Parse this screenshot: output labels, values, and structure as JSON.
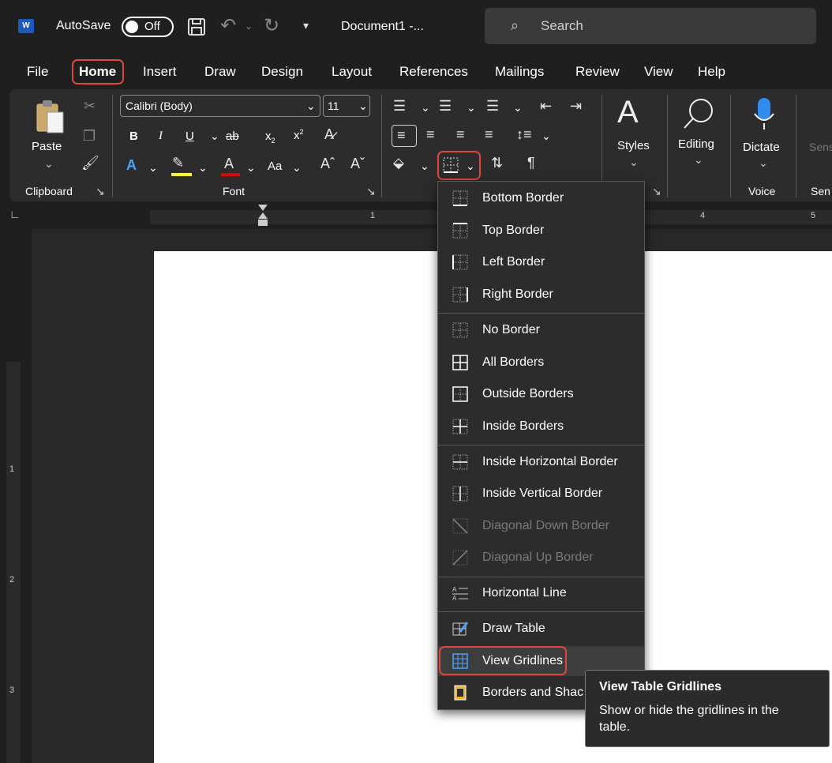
{
  "titlebar": {
    "autosave_label": "AutoSave",
    "autosave_state": "Off",
    "document_name": "Document1 -...",
    "search_placeholder": "Search"
  },
  "tabs": [
    "File",
    "Home",
    "Insert",
    "Draw",
    "Design",
    "Layout",
    "References",
    "Mailings",
    "Review",
    "View",
    "Help"
  ],
  "ribbon": {
    "paste_label": "Paste",
    "clipboard_group": "Clipboard",
    "font_name": "Calibri (Body)",
    "font_size": "11",
    "font_group": "Font",
    "styles_label": "Styles",
    "editing_label": "Editing",
    "dictate_label": "Dictate",
    "voice_group": "Voice",
    "sens_label": "Sens",
    "sens_group": "Sen"
  },
  "ruler": {
    "mark1": "1",
    "mark4": "4",
    "mark5": "5"
  },
  "vruler": {
    "mark1": "1",
    "mark2": "2",
    "mark3": "3"
  },
  "menu": {
    "items": [
      {
        "label": "Bottom Border",
        "icon": "bottom-border-icon",
        "enabled": true
      },
      {
        "label": "Top Border",
        "icon": "top-border-icon",
        "enabled": true
      },
      {
        "label": "Left Border",
        "icon": "left-border-icon",
        "enabled": true
      },
      {
        "label": "Right Border",
        "icon": "right-border-icon",
        "enabled": true
      },
      {
        "label": "No Border",
        "icon": "no-border-icon",
        "enabled": true
      },
      {
        "label": "All Borders",
        "icon": "all-borders-icon",
        "enabled": true
      },
      {
        "label": "Outside Borders",
        "icon": "outside-borders-icon",
        "enabled": true
      },
      {
        "label": "Inside Borders",
        "icon": "inside-borders-icon",
        "enabled": true
      },
      {
        "label": "Inside Horizontal Border",
        "icon": "inside-horizontal-border-icon",
        "enabled": true
      },
      {
        "label": "Inside Vertical Border",
        "icon": "inside-vertical-border-icon",
        "enabled": true
      },
      {
        "label": "Diagonal Down Border",
        "icon": "diagonal-down-border-icon",
        "enabled": false
      },
      {
        "label": "Diagonal Up Border",
        "icon": "diagonal-up-border-icon",
        "enabled": false
      },
      {
        "label": "Horizontal Line",
        "icon": "horizontal-line-icon",
        "enabled": true
      },
      {
        "label": "Draw Table",
        "icon": "draw-table-icon",
        "enabled": true
      },
      {
        "label": "View Gridlines",
        "icon": "view-gridlines-icon",
        "enabled": true
      },
      {
        "label": "Borders and Shac",
        "icon": "borders-shading-icon",
        "enabled": true
      }
    ]
  },
  "tooltip": {
    "title": "View Table Gridlines",
    "description": "Show or hide the gridlines in the table."
  },
  "colors": {
    "highlight": "#e4453a",
    "word_blue": "#185abd",
    "accent_blue": "#4aa3ff",
    "menu_bg": "#2c2c2c"
  }
}
